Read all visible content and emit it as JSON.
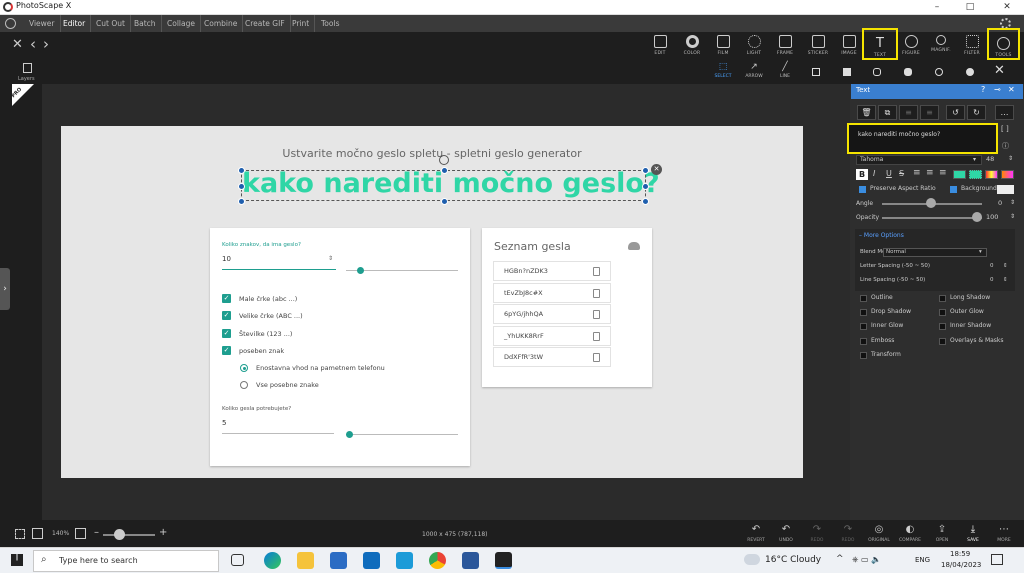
{
  "window": {
    "title": "PhotoScape X",
    "controls": [
      "–",
      "□",
      "✕"
    ]
  },
  "menu": [
    "Viewer",
    "Editor",
    "Cut Out",
    "Batch",
    "Collage",
    "Combine",
    "Create GIF",
    "Print",
    "Tools"
  ],
  "toolbar": {
    "nav": [
      "✕",
      "‹",
      "›"
    ],
    "tools": [
      "EDIT",
      "COLOR",
      "FILM",
      "LIGHT",
      "FRAME",
      "STICKER",
      "IMAGE",
      "TEXT",
      "FIGURE",
      "MAGNIF.",
      "FILTER",
      "TOOLS"
    ]
  },
  "subtoolbar": {
    "tools": [
      "SELECT",
      "ARROW",
      "LINE"
    ]
  },
  "left": {
    "layers_label": "Layers",
    "pro_badge": "PRO"
  },
  "webpage": {
    "subtitle": "Ustvarite močno geslo spletu - spletni geslo generator",
    "length_label": "Koliko znakov, da ima geslo?",
    "length_value": "10",
    "options": [
      "Male črke (abc ...)",
      "Velike črke (ABC ...)",
      "Številke (123 ...)",
      "poseben znak"
    ],
    "radios": [
      "Enostavna vhod na pametnem telefonu",
      "Vse posebne znake"
    ],
    "count_label": "Koliko gesla potrebujete?",
    "count_value": "5",
    "list_title": "Seznam gesla",
    "passwords": [
      "HGBn?nZDK3",
      "tEvZbJ8c#X",
      "6pYG/jhhQA",
      "_YhUKK8RrF",
      "DdXFfR'3tW"
    ]
  },
  "text_object": {
    "value": "kako narediti močno geslo?"
  },
  "panel": {
    "title": "Text",
    "text_value": "kako narediti močno geslo?",
    "font": "Tahoma",
    "font_size": "48",
    "preserve_label": "Preserve Aspect Ratio",
    "background_label": "Background",
    "angle_label": "Angle",
    "angle_value": "0",
    "opacity_label": "Opacity",
    "opacity_value": "100",
    "opacity_pct": 100,
    "more_options": "More Options",
    "blend_label": "Blend Mode",
    "blend_value": "Normal",
    "letter_label": "Letter Spacing (-50 ~ 50)",
    "letter_value": "0",
    "line_label": "Line Spacing (-50 ~ 50)",
    "line_value": "0",
    "effects": [
      "Outline",
      "Long Shadow",
      "Drop Shadow",
      "Outer Glow",
      "Inner Glow",
      "Inner Shadow",
      "Emboss",
      "Overlays & Masks",
      "Transform"
    ],
    "colors": {
      "accent": "#3a7fd0",
      "text_color": "#2fd6a6"
    }
  },
  "status": {
    "zoom": "140%",
    "dimensions": "1000 x 475 (787,118)",
    "tools": [
      "REVERT",
      "UNDO",
      "REDO",
      "REDO",
      "ORIGINAL",
      "COMPARE",
      "OPEN",
      "SAVE",
      "MORE"
    ]
  },
  "taskbar": {
    "search_placeholder": "Type here to search",
    "weather": "16°C  Cloudy",
    "lang": "ENG",
    "time": "18:59",
    "date": "18/04/2023"
  }
}
